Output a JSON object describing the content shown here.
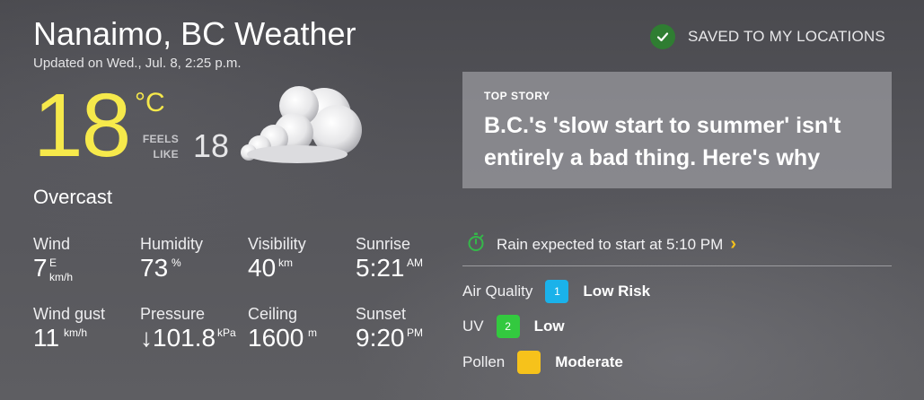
{
  "header": {
    "title": "Nanaimo, BC Weather",
    "updated": "Updated on Wed., Jul. 8, 2:25 p.m.",
    "saved_label": "SAVED TO MY LOCATIONS",
    "saved_icon": "check-icon"
  },
  "current": {
    "temp": "18",
    "unit": "°C",
    "feels_like_label": [
      "FEELS",
      "LIKE"
    ],
    "feels_like": "18",
    "icon": "overcast-cloud-icon",
    "condition": "Overcast"
  },
  "stats": {
    "wind": {
      "label": "Wind",
      "value": "7",
      "dir": "E",
      "unit": "km/h"
    },
    "humidity": {
      "label": "Humidity",
      "value": "73",
      "unit": "%"
    },
    "visibility": {
      "label": "Visibility",
      "value": "40",
      "unit": "km"
    },
    "sunrise": {
      "label": "Sunrise",
      "value": "5:21",
      "unit": "AM"
    },
    "wind_gust": {
      "label": "Wind gust",
      "value": "11",
      "unit": "km/h"
    },
    "pressure": {
      "label": "Pressure",
      "value": "↓101.8",
      "unit": "kPa"
    },
    "ceiling": {
      "label": "Ceiling",
      "value": "1600",
      "unit": "m"
    },
    "sunset": {
      "label": "Sunset",
      "value": "9:20",
      "unit": "PM"
    }
  },
  "top_story": {
    "kicker": "TOP STORY",
    "headline_line1": "B.C.'s 'slow start to summer' isn't",
    "headline_line2": "entirely a bad thing. Here's why"
  },
  "rain_alert": {
    "text": "Rain expected to start at 5:10 PM",
    "icon": "stopwatch-icon",
    "chevron": "›"
  },
  "metrics": {
    "air_quality": {
      "label": "Air Quality",
      "badge": "1",
      "value": "Low Risk",
      "color": "#1ab2ea"
    },
    "uv": {
      "label": "UV",
      "badge": "2",
      "value": "Low",
      "color": "#33c93f"
    },
    "pollen": {
      "label": "Pollen",
      "badge": "",
      "value": "Moderate",
      "color": "#f6c21b"
    }
  },
  "colors": {
    "temp": "#f6e94b",
    "saved_check": "#2f7d32",
    "accent_chevron": "#f6c21b",
    "stopwatch": "#35b84a"
  }
}
